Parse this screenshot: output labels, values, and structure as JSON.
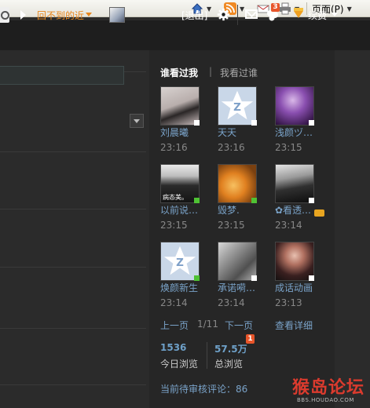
{
  "ie_toolbar": {
    "page_label": "页面(P)",
    "icons": [
      "home-icon",
      "rss-icon",
      "mail-icon",
      "print-icon"
    ],
    "colors": {
      "home": "#3a6fc0",
      "rss": "#f08a24",
      "print": "#7c7c7c"
    }
  },
  "header": {
    "user_name": "回不到的近",
    "logout_label": "[退出]",
    "notify_count": "3",
    "renew_label": "续费",
    "colors": {
      "user": "#e8871e",
      "badge": "#e8552a"
    }
  },
  "visitors": {
    "tab_active": "谁看过我",
    "divider": "|",
    "tab_other": "我看过谁",
    "items": [
      {
        "name": "刘晨曦",
        "time": "23:16",
        "online": false
      },
      {
        "name": "天天",
        "time": "23:16",
        "online": false
      },
      {
        "name": "浅颜ヅ…",
        "time": "23:15",
        "online": false
      },
      {
        "name": "以前说…",
        "time": "23:15",
        "online": true,
        "thumb_text": "病态美。"
      },
      {
        "name": "毁梦.",
        "time": "23:15",
        "online": true
      },
      {
        "name": "✿看透…",
        "time": "23:14",
        "online": false,
        "vip": true
      },
      {
        "name": "焕颜新生",
        "time": "23:14",
        "online": true
      },
      {
        "name": "承诺嗬…",
        "time": "23:14",
        "online": false
      },
      {
        "name": "成话动画",
        "time": "23:13",
        "online": false
      }
    ],
    "pager": {
      "prev": "上一页",
      "page": "1/11",
      "next": "下一页",
      "detail": "查看详细"
    }
  },
  "stats": {
    "today_value": "1536",
    "today_label": "今日浏览",
    "total_value": "57.5万",
    "total_label": "总浏览",
    "total_badge": "1",
    "pending": "当前待审核评论：86"
  },
  "watermark": {
    "logo": "猴岛论坛",
    "url": "BBS.HOUDAO.COM"
  }
}
